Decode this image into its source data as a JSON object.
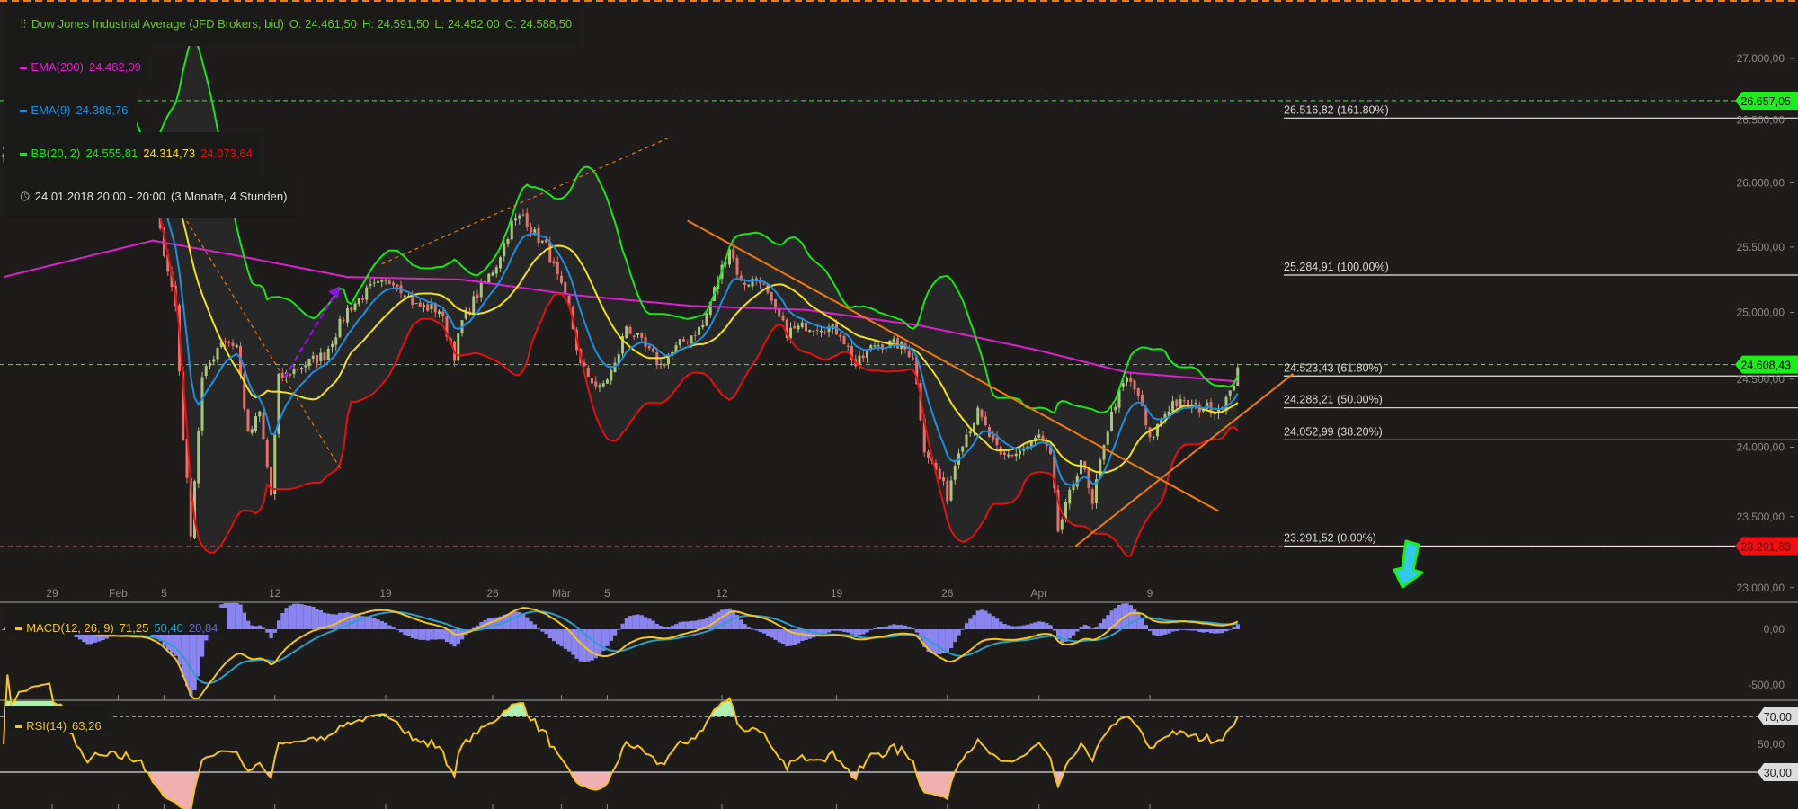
{
  "header": {
    "instrument": "Dow Jones Industrial Average (JFD Brokers, bid)",
    "open": "O: 24.461,50",
    "high": "H: 24.591,50",
    "low": "L: 24.452,00",
    "close": "C: 24.588,50",
    "ema200_label": "EMA(200)",
    "ema200_value": "24.482,09",
    "ema9_label": "EMA(9)",
    "ema9_value": "24.386,76",
    "bb_label": "BB(20, 2)",
    "bb_upper": "24.555,81",
    "bb_mid": "24.314,73",
    "bb_lower": "24.073,64",
    "period": "24.01.2018 20:00 - 20:00",
    "period_detail": "(3 Monate, 4 Stunden)"
  },
  "macd_legend": {
    "label": "MACD(12, 26, 9)",
    "macd": "71,25",
    "signal": "50,40",
    "hist": "20,84"
  },
  "rsi_legend": {
    "label": "RSI(14)",
    "value": "63,26"
  },
  "colors": {
    "background": "#1d1c1b",
    "up": "#a9c47c",
    "down": "#e5716a",
    "ema200": "#e020d0",
    "ema9": "#1e8fe0",
    "bb_outer_upper": "#19e619",
    "bb_outer_lower": "#e61010",
    "bb_mid": "#f2e21a",
    "macd": "#f5c518",
    "signal": "#2aa0c8",
    "hist": "#8a84f0",
    "rsi": "#f5c518",
    "trend": "#f07a10",
    "arrow": "#9010e0"
  },
  "chart_data": {
    "type": "candlestick",
    "title": "Dow Jones Industrial Average (JFD Brokers, bid)",
    "timeframe": "4 Stunden",
    "ylim": [
      22950,
      27150
    ],
    "y_ticks": [
      "27.000,00",
      "26.500,00",
      "26.000,00",
      "25.500,00",
      "25.000,00",
      "24.500,00",
      "24.000,00",
      "23.500,00",
      "23.000,00"
    ],
    "y_tick_values": [
      27000,
      26500,
      26000,
      25500,
      25000,
      24500,
      24000,
      23500,
      23000
    ],
    "x_ticks": [
      {
        "label": "29",
        "bar": 12.7
      },
      {
        "label": "Feb",
        "bar": 30
      },
      {
        "label": "5",
        "bar": 42
      },
      {
        "label": "12",
        "bar": 71
      },
      {
        "label": "19",
        "bar": 100
      },
      {
        "label": "26",
        "bar": 128
      },
      {
        "label": "Mär",
        "bar": 146
      },
      {
        "label": "5",
        "bar": 158
      },
      {
        "label": "12",
        "bar": 188
      },
      {
        "label": "19",
        "bar": 218
      },
      {
        "label": "26",
        "bar": 247
      },
      {
        "label": "Apr",
        "bar": 271
      },
      {
        "label": "9",
        "bar": 300
      }
    ],
    "close_path": [
      [
        0,
        26270
      ],
      [
        12,
        26600
      ],
      [
        16,
        26500
      ],
      [
        21,
        26150
      ],
      [
        30,
        26150
      ],
      [
        36,
        26100
      ],
      [
        40,
        25750
      ],
      [
        45,
        25050
      ],
      [
        47,
        24080
      ],
      [
        49,
        23400
      ],
      [
        52,
        24500
      ],
      [
        57,
        24800
      ],
      [
        61,
        24750
      ],
      [
        64,
        24080
      ],
      [
        67,
        24250
      ],
      [
        70,
        23650
      ],
      [
        72,
        24500
      ],
      [
        78,
        24600
      ],
      [
        84,
        24680
      ],
      [
        90,
        25020
      ],
      [
        96,
        25180
      ],
      [
        102,
        25250
      ],
      [
        108,
        25050
      ],
      [
        114,
        25020
      ],
      [
        118,
        24680
      ],
      [
        120,
        24930
      ],
      [
        124,
        25140
      ],
      [
        129,
        25370
      ],
      [
        133,
        25680
      ],
      [
        136,
        25750
      ],
      [
        139,
        25600
      ],
      [
        142,
        25500
      ],
      [
        145,
        25260
      ],
      [
        148,
        25020
      ],
      [
        151,
        24600
      ],
      [
        156,
        24420
      ],
      [
        160,
        24600
      ],
      [
        163,
        24900
      ],
      [
        168,
        24730
      ],
      [
        172,
        24600
      ],
      [
        177,
        24760
      ],
      [
        183,
        24900
      ],
      [
        187,
        25260
      ],
      [
        190,
        25500
      ],
      [
        193,
        25220
      ],
      [
        198,
        25260
      ],
      [
        201,
        25050
      ],
      [
        205,
        24850
      ],
      [
        210,
        24900
      ],
      [
        214,
        24900
      ],
      [
        219,
        24850
      ],
      [
        223,
        24600
      ],
      [
        228,
        24760
      ],
      [
        234,
        24760
      ],
      [
        238,
        24680
      ],
      [
        241,
        24000
      ],
      [
        244,
        23830
      ],
      [
        247,
        23650
      ],
      [
        250,
        24000
      ],
      [
        255,
        24250
      ],
      [
        258,
        24080
      ],
      [
        261,
        23920
      ],
      [
        265,
        23960
      ],
      [
        268,
        24000
      ],
      [
        271,
        24080
      ],
      [
        274,
        23920
      ],
      [
        276,
        23400
      ],
      [
        279,
        23650
      ],
      [
        282,
        23920
      ],
      [
        285,
        23570
      ],
      [
        288,
        24040
      ],
      [
        291,
        24330
      ],
      [
        294,
        24500
      ],
      [
        297,
        24380
      ],
      [
        300,
        24040
      ],
      [
        303,
        24210
      ],
      [
        306,
        24330
      ],
      [
        312,
        24290
      ],
      [
        318,
        24290
      ],
      [
        321,
        24380
      ],
      [
        323,
        24588
      ]
    ],
    "ema200_path": [
      [
        0,
        25270
      ],
      [
        39,
        25550
      ],
      [
        60,
        25440
      ],
      [
        90,
        25270
      ],
      [
        120,
        25250
      ],
      [
        150,
        25130
      ],
      [
        180,
        25050
      ],
      [
        210,
        25020
      ],
      [
        240,
        24900
      ],
      [
        270,
        24720
      ],
      [
        294,
        24550
      ],
      [
        323,
        24482
      ]
    ],
    "fib_levels": [
      {
        "price": 26516.82,
        "label": "26.516,82 (161.80%)"
      },
      {
        "price": 25284.91,
        "label": "25.284,91 (100.00%)"
      },
      {
        "price": 24523.43,
        "label": "24.523,43 (61.80%)"
      },
      {
        "price": 24288.21,
        "label": "24.288,21 (50.00%)"
      },
      {
        "price": 24052.99,
        "label": "24.052,99 (38.20%)"
      },
      {
        "price": 23291.52,
        "label": "23.291,52 (0.00%)"
      }
    ],
    "price_tags": [
      {
        "price": 26657.05,
        "label": "26.657,05",
        "color": "#19f019",
        "text": "#000000"
      },
      {
        "price": 24608.43,
        "label": "24.608,43",
        "color": "#19f019",
        "text": "#000000"
      },
      {
        "price": 23291.83,
        "label": "23.291,83",
        "color": "#ee1010",
        "text": "#5a0000"
      }
    ],
    "trendlines": [
      {
        "from": [
          179,
          25705
        ],
        "to": [
          318,
          23540
        ],
        "style": "solid"
      },
      {
        "from": [
          42,
          25990
        ],
        "to": [
          88.5,
          23830
        ],
        "style": "dashed"
      },
      {
        "from": [
          99,
          25370
        ],
        "to": [
          175,
          26370
        ],
        "style": "dashed"
      },
      {
        "from": [
          280.5,
          23290
        ],
        "to": [
          337.5,
          24540
        ],
        "style": "solid"
      }
    ],
    "arrow_drawing": {
      "from": [
        73.5,
        24510
      ],
      "to": [
        88,
        25200
      ]
    },
    "macd": {
      "ticks": [
        "0,00",
        "-500,00"
      ],
      "tick_values": [
        0,
        -500
      ]
    },
    "rsi": {
      "ticks": [
        "70,00",
        "50,00",
        "30,00"
      ],
      "tick_values": [
        70,
        50,
        30
      ],
      "overbought": 70,
      "oversold": 30
    }
  }
}
